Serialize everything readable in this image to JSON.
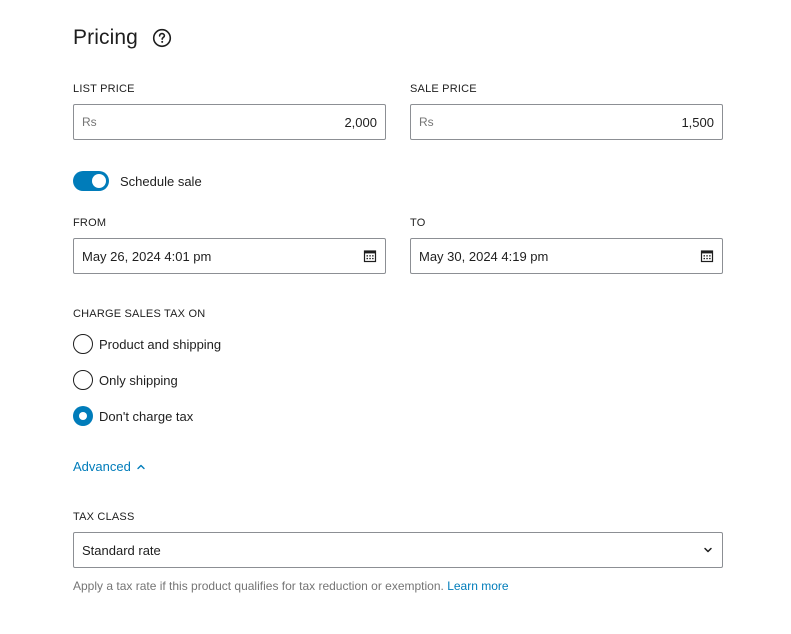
{
  "section": {
    "title": "Pricing",
    "help_icon": "question-circle-icon"
  },
  "list_price": {
    "label": "LIST PRICE",
    "prefix": "Rs",
    "value": "2,000"
  },
  "sale_price": {
    "label": "SALE PRICE",
    "prefix": "Rs",
    "value": "1,500"
  },
  "schedule_sale": {
    "label": "Schedule sale",
    "enabled": true
  },
  "from": {
    "label": "FROM",
    "value": "May 26, 2024 4:01 pm",
    "icon": "calendar-icon"
  },
  "to": {
    "label": "TO",
    "value": "May 30, 2024 4:19 pm",
    "icon": "calendar-icon"
  },
  "charge_tax": {
    "label": "CHARGE SALES TAX ON",
    "options": [
      {
        "label": "Product and shipping",
        "checked": false
      },
      {
        "label": "Only shipping",
        "checked": false
      },
      {
        "label": "Don't charge tax",
        "checked": true
      }
    ]
  },
  "advanced": {
    "label": "Advanced",
    "expanded": true
  },
  "tax_class": {
    "label": "TAX CLASS",
    "value": "Standard rate",
    "help_text": "Apply a tax rate if this product qualifies for tax reduction or exemption.",
    "learn_more": "Learn more"
  },
  "colors": {
    "accent": "#007cba",
    "text": "#1e1e1e",
    "muted": "#757575",
    "border": "#8c8f94"
  }
}
